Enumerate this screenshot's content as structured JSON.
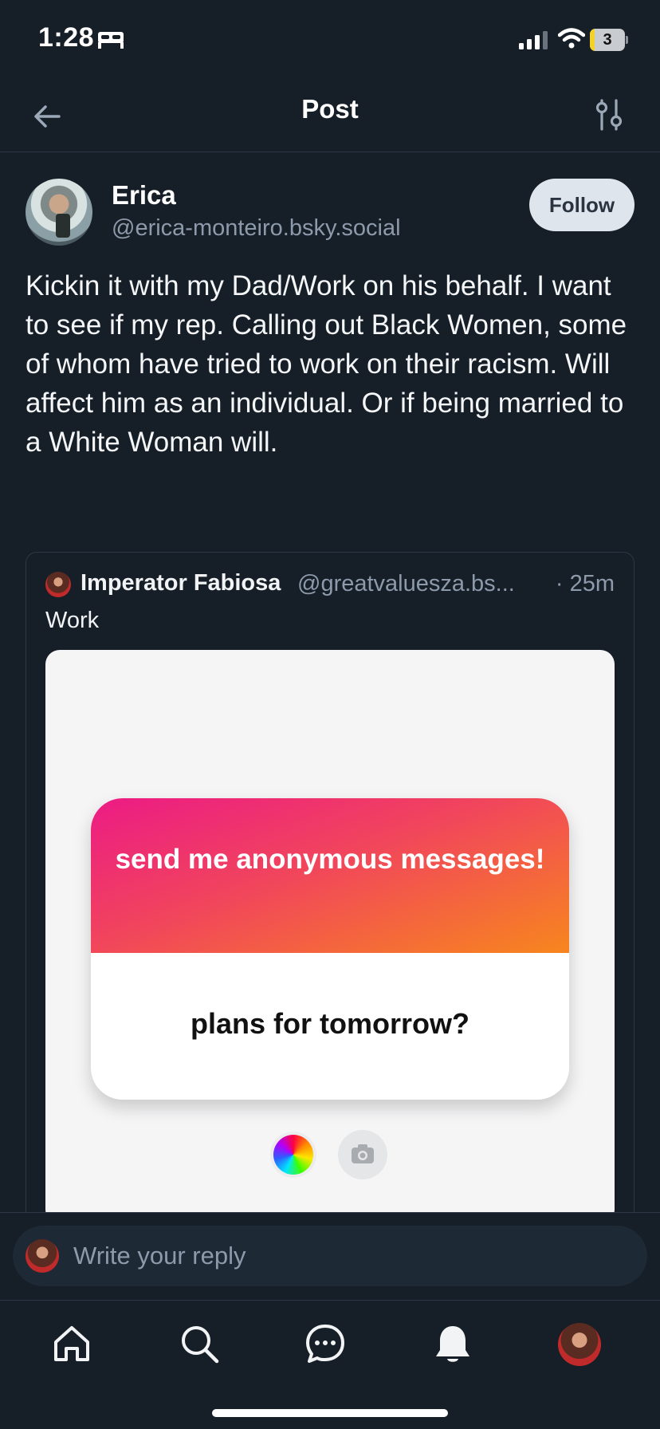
{
  "status_bar": {
    "time": "1:28",
    "battery_level": "3",
    "battery_fraction": 0.03,
    "battery_color": "#f2d22a"
  },
  "header": {
    "title": "Post",
    "back_icon": "arrow-left-icon",
    "settings_icon": "sliders-icon"
  },
  "post": {
    "author_name": "Erica",
    "author_handle": "@erica-monteiro.bsky.social",
    "follow_label": "Follow",
    "text": "Kickin it with my Dad/Work on his behalf. I want to see if my rep. Calling out Black Women, some of whom have tried to work on their racism. Will affect him as an individual. Or if being married to a White Woman will."
  },
  "quote": {
    "author_name": "Imperator Fabiosa",
    "author_handle": "@greatvaluesza.bs...",
    "time": "· 25m",
    "text": "Work",
    "image": {
      "card_title": "send me anonymous messages!",
      "card_question": "plans for tomorrow?"
    }
  },
  "reply": {
    "placeholder": "Write your reply"
  },
  "tab_bar": {
    "items": [
      "home-icon",
      "search-icon",
      "chat-icon",
      "bell-icon",
      "profile-avatar"
    ]
  },
  "colors": {
    "background": "#161e27",
    "accent_text": "#8d9aab",
    "follow_bg": "#dfe5ec"
  }
}
